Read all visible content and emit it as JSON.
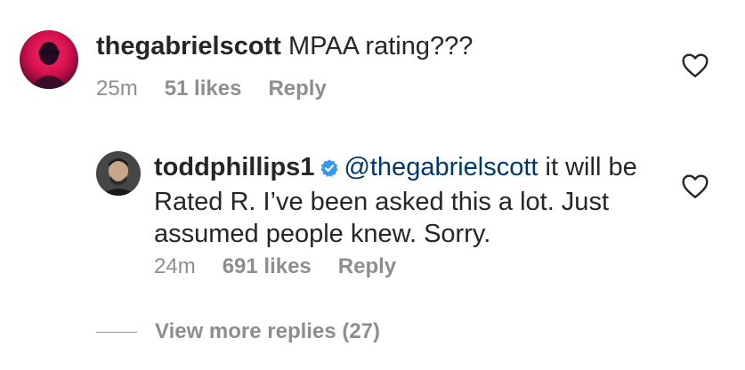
{
  "comments": [
    {
      "username": "thegabrielscott",
      "text": "MPAA rating???",
      "time": "25m",
      "likes": "51 likes",
      "reply_label": "Reply"
    }
  ],
  "replies": [
    {
      "username": "toddphillips1",
      "verified": true,
      "mention": "@thegabrielscott",
      "text_line1": " it will be",
      "text_line2": "Rated R. I’ve been asked this a lot. Just",
      "text_line3": "assumed people knew. Sorry.",
      "time": "24m",
      "likes": "691 likes",
      "reply_label": "Reply"
    }
  ],
  "view_more": "View more replies (27)",
  "colors": {
    "text": "#262626",
    "meta": "#8e8e8e",
    "mention": "#00376b",
    "verified": "#3897f0"
  },
  "icons": {
    "like": "heart-outline-icon",
    "verified": "verified-badge-icon"
  }
}
